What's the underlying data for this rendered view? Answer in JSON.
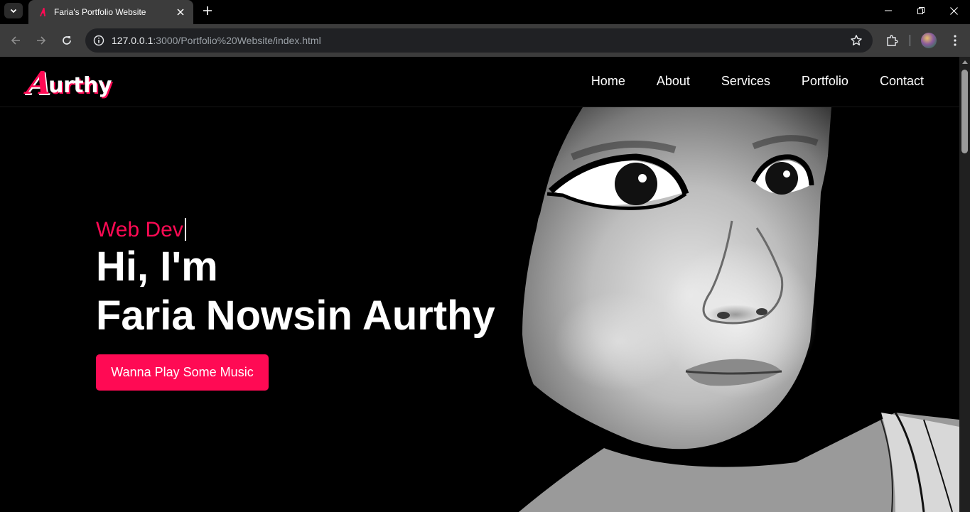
{
  "browser": {
    "tab_title": "Faria's Portfolio Website",
    "url_host": "127.0.0.1",
    "url_path": ":3000/Portfolio%20Website/index.html"
  },
  "site": {
    "logo_first": "A",
    "logo_rest": "urthy",
    "nav": [
      "Home",
      "About",
      "Services",
      "Portfolio",
      "Contact"
    ],
    "hero": {
      "role": "Web Dev",
      "greeting": "Hi, I'm",
      "name": "Faria Nowsin Aurthy",
      "cta": "Wanna Play Some Music"
    }
  },
  "colors": {
    "accent": "#ff0a54",
    "background": "#000000",
    "chrome": "#3c3c3c"
  }
}
